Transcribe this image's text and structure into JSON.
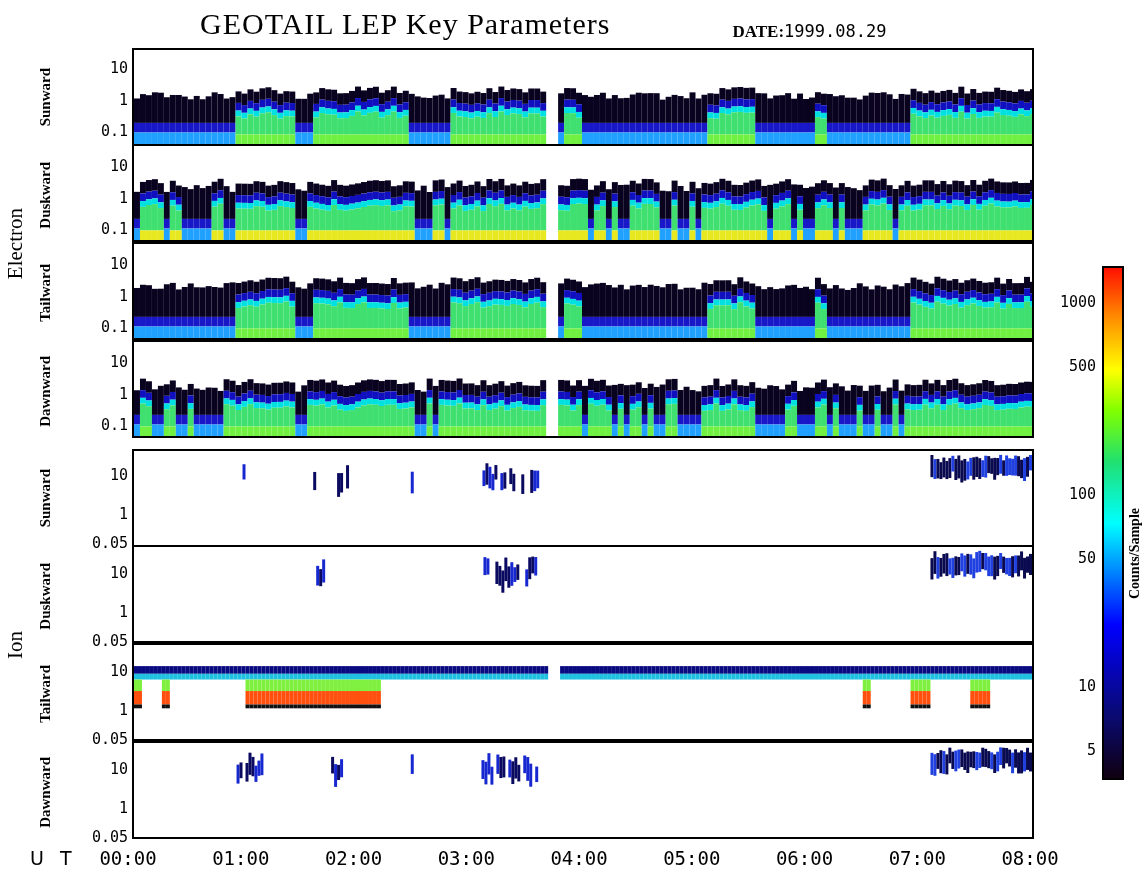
{
  "title": "GEOTAIL LEP Key Parameters",
  "date": {
    "label": "DATE:",
    "value": "1999.08.29"
  },
  "groups": [
    {
      "label": "Electron",
      "kind": "electron",
      "panels": [
        {
          "label": "Sunward",
          "y_ticks": [
            "10",
            "1",
            "0.1"
          ]
        },
        {
          "label": "Duskward",
          "y_ticks": [
            "10",
            "1",
            "0.1"
          ]
        },
        {
          "label": "Tailward",
          "y_ticks": [
            "10",
            "1",
            "0.1"
          ]
        },
        {
          "label": "Dawnward",
          "y_ticks": [
            "10",
            "1",
            "0.1"
          ]
        }
      ]
    },
    {
      "label": "Ion",
      "kind": "ion",
      "panels": [
        {
          "label": "Sunward",
          "y_ticks": [
            "10",
            "1",
            "0.05"
          ]
        },
        {
          "label": "Duskward",
          "y_ticks": [
            "10",
            "1",
            "0.05"
          ]
        },
        {
          "label": "Tailward",
          "y_ticks": [
            "10",
            "1",
            "0.05"
          ]
        },
        {
          "label": "Dawnward",
          "y_ticks": [
            "10",
            "1",
            "0.05"
          ]
        }
      ]
    }
  ],
  "x_axis": {
    "label": "U T",
    "ticks": [
      "00:00",
      "01:00",
      "02:00",
      "03:00",
      "04:00",
      "05:00",
      "06:00",
      "07:00",
      "08:00"
    ]
  },
  "colorbar": {
    "title": "Counts/Sample",
    "ticks": [
      "1000",
      "500",
      "100",
      "50",
      "10",
      "5"
    ]
  }
}
